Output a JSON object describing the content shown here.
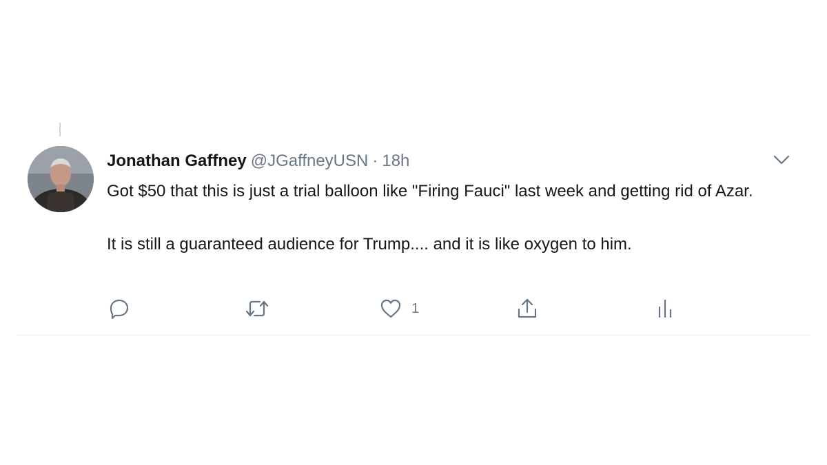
{
  "tweet": {
    "author_name": "Jonathan Gaffney",
    "handle": "@JGaffneyUSN",
    "separator": "·",
    "time": "18h",
    "text_paragraphs": [
      "Got $50 that this is just a trial balloon like \"Firing Fauci\" last week and getting rid of Azar.",
      "It is still a guaranteed audience for Trump.... and it is like oxygen to him."
    ],
    "actions": {
      "reply_icon": "reply-icon",
      "retweet_icon": "retweet-icon",
      "like_icon": "like-icon",
      "like_count": "1",
      "share_icon": "share-icon",
      "analytics_icon": "analytics-icon"
    },
    "menu_icon": "chevron-down-icon"
  },
  "colors": {
    "text_primary": "#14171a",
    "text_secondary": "#657786",
    "divider": "#e6ecf0"
  }
}
